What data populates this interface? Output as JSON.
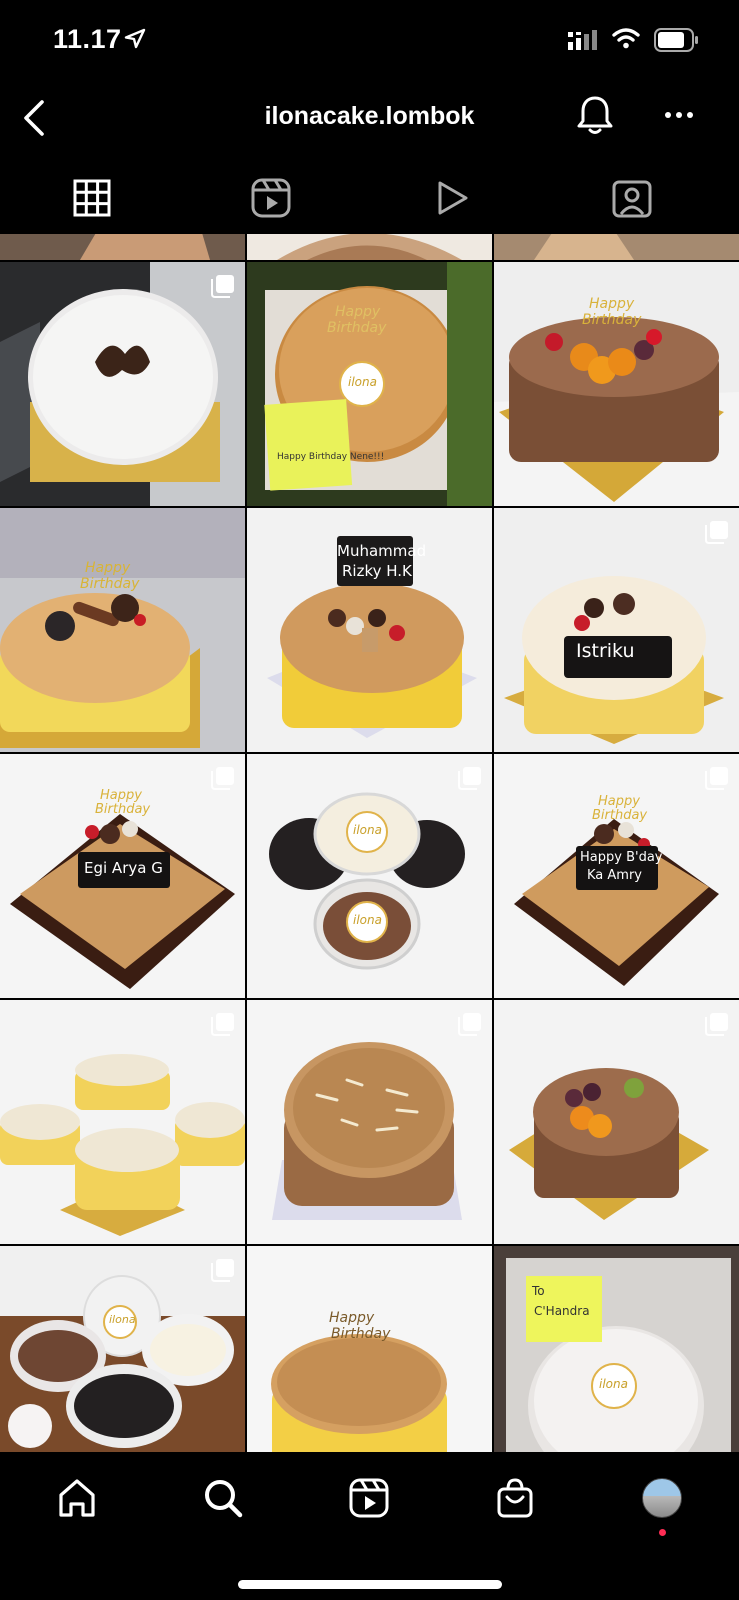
{
  "status_bar": {
    "time": "11.17"
  },
  "header": {
    "title": "ilonacake.lombok"
  },
  "tabs": [
    {
      "name": "posts-grid",
      "icon": "grid-icon",
      "active": true
    },
    {
      "name": "reels",
      "icon": "reels-icon",
      "active": false
    },
    {
      "name": "videos",
      "icon": "play-icon",
      "active": false
    },
    {
      "name": "tagged",
      "icon": "tagged-person-icon",
      "active": false
    }
  ],
  "posts": [
    {
      "caption": ""
    },
    {
      "caption": ""
    },
    {
      "caption": ""
    },
    {
      "caption": "Muhammad Rizky H.K"
    },
    {
      "caption": "Istriku"
    },
    {
      "caption": "Egi Arya G"
    },
    {
      "caption": "Happy B'day Ka Amry"
    },
    {
      "caption": "To C'Handra"
    }
  ],
  "tile_text": {
    "happy": "Happy",
    "birthday": "Birthday",
    "brand": "ilona",
    "note": "Happy Birthday Nene!!!",
    "muhammad": "Muhammad",
    "rizky": "Rizky H.K",
    "istriku": "Istriku",
    "egi": "Egi Arya G",
    "bday1": "Happy B'day",
    "bday2": "Ka Amry",
    "to": "To",
    "chandra": "C'Handra"
  },
  "bottom_nav": [
    "home-icon",
    "search-icon",
    "reels-icon",
    "shop-icon",
    "profile-avatar"
  ],
  "colors": {
    "background": "#000000",
    "notification_dot": "#ff2d55"
  }
}
